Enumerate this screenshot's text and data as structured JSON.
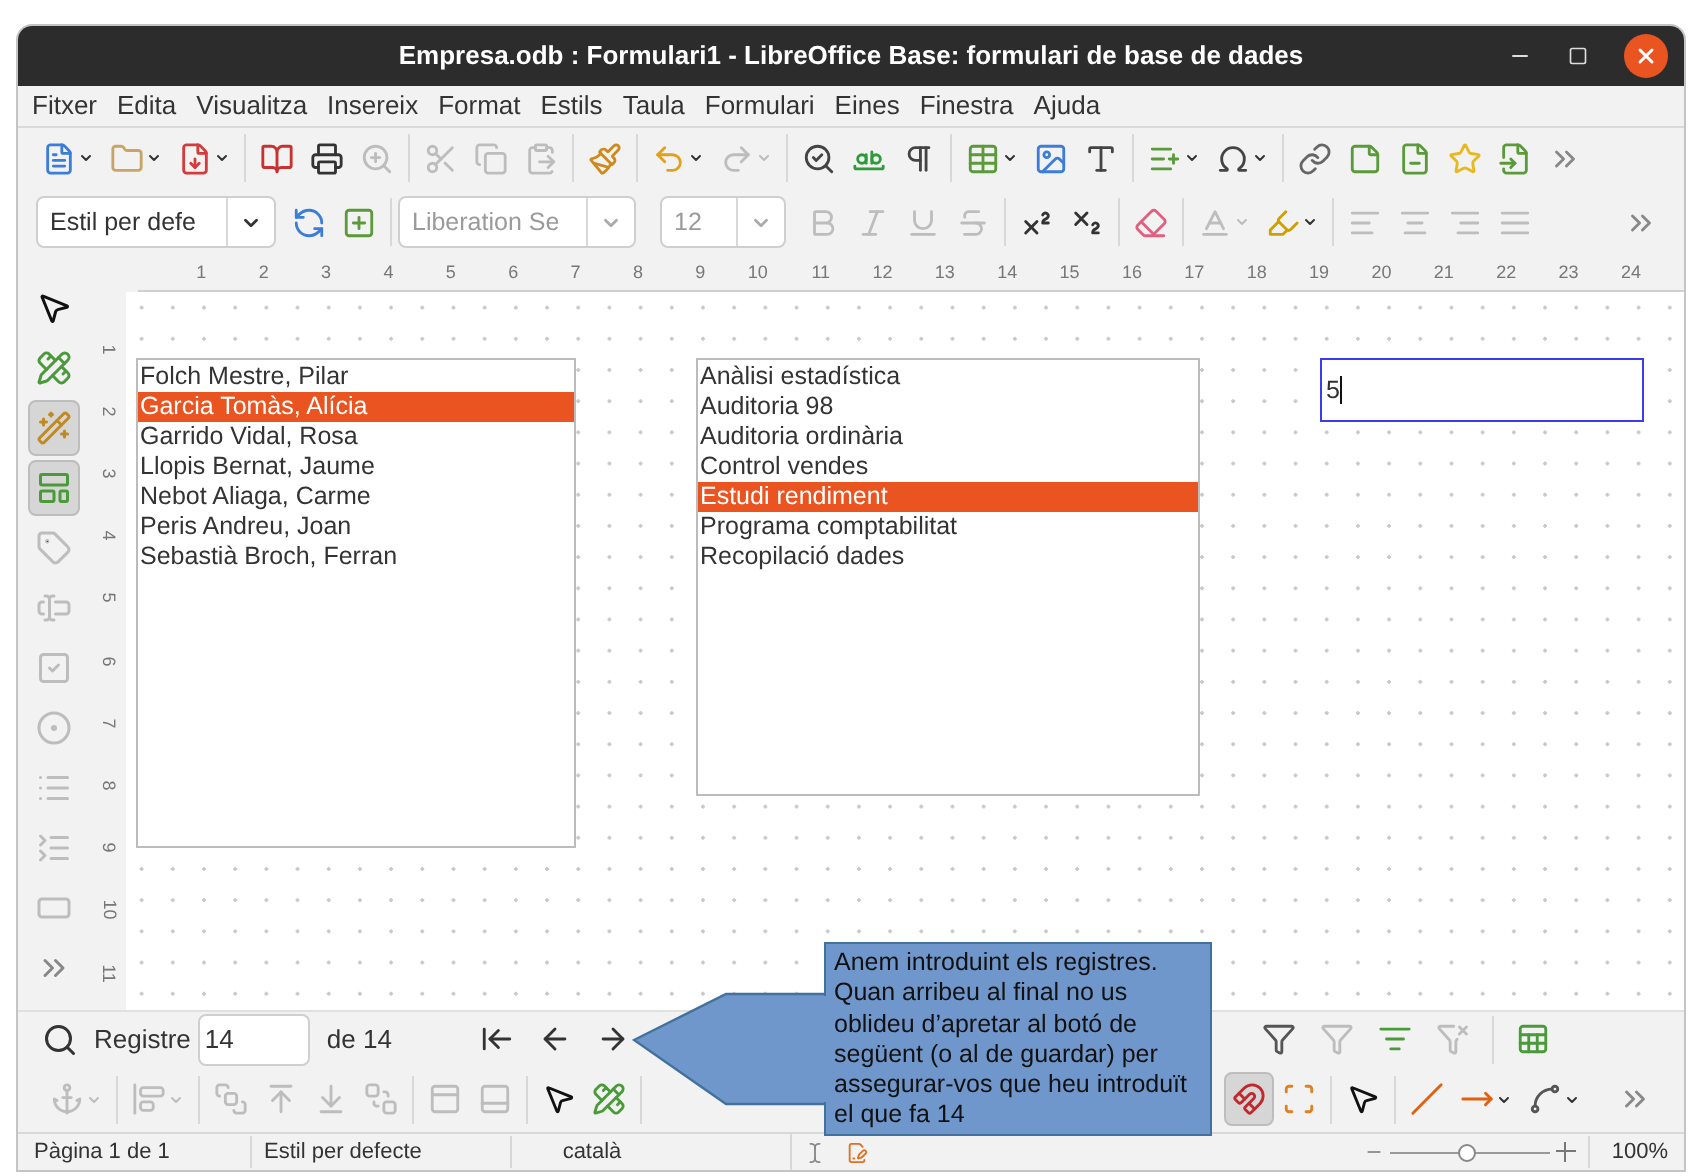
{
  "window": {
    "title": "Empresa.odb : Formulari1 - LibreOffice Base: formulari de base de dades"
  },
  "menu": [
    "Fitxer",
    "Edita",
    "Visualitza",
    "Insereix",
    "Format",
    "Estils",
    "Taula",
    "Formulari",
    "Eines",
    "Finestra",
    "Ajuda"
  ],
  "standard_toolbar": [
    {
      "kind": "new",
      "disabled": false,
      "dropdown": true
    },
    {
      "kind": "open",
      "disabled": false,
      "dropdown": true
    },
    {
      "kind": "save",
      "disabled": false,
      "dropdown": true
    },
    {
      "kind": "sep"
    },
    {
      "kind": "pdf",
      "disabled": false,
      "dropdown": false
    },
    {
      "kind": "print",
      "disabled": false,
      "dropdown": false
    },
    {
      "kind": "preview",
      "disabled": true,
      "dropdown": false
    },
    {
      "kind": "sep"
    },
    {
      "kind": "cut",
      "disabled": true,
      "dropdown": false
    },
    {
      "kind": "copy",
      "disabled": true,
      "dropdown": false
    },
    {
      "kind": "paste",
      "disabled": true,
      "dropdown": false
    },
    {
      "kind": "sep"
    },
    {
      "kind": "clone",
      "disabled": false,
      "dropdown": false
    },
    {
      "kind": "sep"
    },
    {
      "kind": "undo",
      "disabled": false,
      "dropdown": true
    },
    {
      "kind": "redo",
      "disabled": true,
      "dropdown": true
    },
    {
      "kind": "sep"
    },
    {
      "kind": "spelling",
      "disabled": false,
      "dropdown": false
    },
    {
      "kind": "autocorrect",
      "disabled": false,
      "dropdown": false
    },
    {
      "kind": "marks",
      "disabled": false,
      "dropdown": false
    },
    {
      "kind": "sep"
    },
    {
      "kind": "table",
      "disabled": false,
      "dropdown": true
    },
    {
      "kind": "image",
      "disabled": false,
      "dropdown": false
    },
    {
      "kind": "textbox",
      "disabled": false,
      "dropdown": false
    },
    {
      "kind": "sep"
    },
    {
      "kind": "list",
      "disabled": false,
      "dropdown": true
    },
    {
      "kind": "special",
      "disabled": false,
      "dropdown": true
    },
    {
      "kind": "sep"
    },
    {
      "kind": "hyperlink",
      "disabled": false,
      "dropdown": false
    },
    {
      "kind": "footnote",
      "disabled": false,
      "dropdown": false
    },
    {
      "kind": "endnote",
      "disabled": false,
      "dropdown": false
    },
    {
      "kind": "bookmark",
      "disabled": false,
      "dropdown": false
    },
    {
      "kind": "crossref",
      "disabled": false,
      "dropdown": false
    },
    {
      "kind": "more",
      "disabled": false,
      "dropdown": false
    }
  ],
  "formatting_toolbar": {
    "paragraph_style": {
      "value": "Estil per defe",
      "disabled": false
    },
    "font_name": {
      "value": "Liberation Se",
      "disabled": true
    },
    "font_size": {
      "value": "12",
      "disabled": true
    },
    "buttons": [
      {
        "kind": "update_style",
        "disabled": false,
        "dropdown": false
      },
      {
        "kind": "new_style",
        "disabled": false,
        "dropdown": false
      },
      {
        "kind": "sep"
      },
      {
        "kind": "bold",
        "disabled": true,
        "dropdown": false
      },
      {
        "kind": "italic",
        "disabled": true,
        "dropdown": false
      },
      {
        "kind": "underline",
        "disabled": true,
        "dropdown": false
      },
      {
        "kind": "strike",
        "disabled": true,
        "dropdown": false
      },
      {
        "kind": "sep"
      },
      {
        "kind": "superscript",
        "disabled": false,
        "dropdown": false
      },
      {
        "kind": "subscript",
        "disabled": false,
        "dropdown": false
      },
      {
        "kind": "sep"
      },
      {
        "kind": "clear",
        "disabled": false,
        "dropdown": false
      },
      {
        "kind": "sep"
      },
      {
        "kind": "fontcolor",
        "disabled": true,
        "dropdown": true
      },
      {
        "kind": "highlight",
        "disabled": false,
        "dropdown": true
      },
      {
        "kind": "sep"
      },
      {
        "kind": "align_left",
        "disabled": true,
        "dropdown": false
      },
      {
        "kind": "align_center",
        "disabled": true,
        "dropdown": false
      },
      {
        "kind": "align_right",
        "disabled": true,
        "dropdown": false
      },
      {
        "kind": "justify",
        "disabled": true,
        "dropdown": false
      },
      {
        "kind": "gap"
      },
      {
        "kind": "more",
        "disabled": false,
        "dropdown": false
      }
    ]
  },
  "ruler": {
    "horizontal": [
      "1",
      "2",
      "3",
      "4",
      "5",
      "6",
      "7",
      "8",
      "9",
      "10",
      "11",
      "12",
      "13",
      "14",
      "15",
      "16",
      "17",
      "18",
      "19",
      "20",
      "21",
      "22",
      "23",
      "24"
    ],
    "vertical": [
      "1",
      "2",
      "3",
      "4",
      "5",
      "6",
      "7",
      "8",
      "9",
      "10",
      "11"
    ]
  },
  "form_controls_toolbar": [
    {
      "kind": "select",
      "on": false,
      "disabled": false
    },
    {
      "kind": "design",
      "on": false,
      "disabled": false
    },
    {
      "kind": "wizards",
      "on": true,
      "disabled": false
    },
    {
      "kind": "form_design",
      "on": true,
      "disabled": false
    },
    {
      "kind": "label",
      "on": false,
      "disabled": true
    },
    {
      "kind": "text",
      "on": false,
      "disabled": true
    },
    {
      "kind": "checkbox",
      "on": false,
      "disabled": true
    },
    {
      "kind": "radio",
      "on": false,
      "disabled": true
    },
    {
      "kind": "listbox",
      "on": false,
      "disabled": true
    },
    {
      "kind": "combobox",
      "on": false,
      "disabled": true
    },
    {
      "kind": "pushbutton",
      "on": false,
      "disabled": true
    },
    {
      "kind": "more",
      "on": false,
      "disabled": false
    }
  ],
  "form": {
    "employees_list": [
      {
        "label": "Folch Mestre, Pilar",
        "selected": false
      },
      {
        "label": "Garcia Tomàs, Alícia",
        "selected": true
      },
      {
        "label": "Garrido Vidal, Rosa",
        "selected": false
      },
      {
        "label": "Llopis Bernat, Jaume",
        "selected": false
      },
      {
        "label": "Nebot Aliaga, Carme",
        "selected": false
      },
      {
        "label": "Peris Andreu, Joan",
        "selected": false
      },
      {
        "label": "Sebastià Broch, Ferran",
        "selected": false
      }
    ],
    "projects_list": [
      {
        "label": "Anàlisi estadística",
        "selected": false
      },
      {
        "label": "Auditoria 98",
        "selected": false
      },
      {
        "label": "Auditoria ordinària",
        "selected": false
      },
      {
        "label": "Control vendes",
        "selected": false
      },
      {
        "label": "Estudi rendiment",
        "selected": true
      },
      {
        "label": "Programa comptabilitat",
        "selected": false
      },
      {
        "label": "Recopilació dades",
        "selected": false
      }
    ],
    "hours_field": {
      "value": "5",
      "focused": true
    }
  },
  "navigation_toolbar": {
    "record_label": "Registre",
    "record_value": "14",
    "record_total": "de 14",
    "buttons": [
      {
        "kind": "first",
        "disabled": false
      },
      {
        "kind": "prev",
        "disabled": false
      },
      {
        "kind": "next",
        "disabled": false
      }
    ],
    "filter_buttons": [
      {
        "kind": "autofilter",
        "disabled": false
      },
      {
        "kind": "apply_filter",
        "disabled": true
      },
      {
        "kind": "standard_filter",
        "disabled": false
      },
      {
        "kind": "reset_filter",
        "disabled": true
      },
      {
        "kind": "sep"
      },
      {
        "kind": "data_to_text",
        "disabled": false
      }
    ]
  },
  "form_design_toolbar": [
    {
      "kind": "anchor",
      "disabled": true,
      "dropdown": true,
      "on": false
    },
    {
      "kind": "sep"
    },
    {
      "kind": "align",
      "disabled": true,
      "dropdown": true,
      "on": false
    },
    {
      "kind": "sep"
    },
    {
      "kind": "front",
      "disabled": true,
      "dropdown": false,
      "on": false
    },
    {
      "kind": "forward",
      "disabled": true,
      "dropdown": false,
      "on": false
    },
    {
      "kind": "backward",
      "disabled": true,
      "dropdown": false,
      "on": false
    },
    {
      "kind": "back",
      "disabled": true,
      "dropdown": false,
      "on": false
    },
    {
      "kind": "sep"
    },
    {
      "kind": "header",
      "disabled": true,
      "dropdown": false,
      "on": false
    },
    {
      "kind": "footer",
      "disabled": true,
      "dropdown": false,
      "on": false
    },
    {
      "kind": "sep"
    },
    {
      "kind": "select",
      "disabled": false,
      "dropdown": false,
      "on": false
    },
    {
      "kind": "design",
      "disabled": false,
      "dropdown": false,
      "on": false
    },
    {
      "kind": "sep"
    },
    {
      "kind": "hidden"
    },
    {
      "kind": "snap",
      "disabled": false,
      "dropdown": false,
      "on": true
    },
    {
      "kind": "helplines",
      "disabled": false,
      "dropdown": false,
      "on": false
    },
    {
      "kind": "sep"
    },
    {
      "kind": "select",
      "disabled": false,
      "dropdown": false,
      "on": false
    },
    {
      "kind": "sep"
    },
    {
      "kind": "line",
      "disabled": false,
      "dropdown": false,
      "on": false
    },
    {
      "kind": "arrow",
      "disabled": false,
      "dropdown": true,
      "on": false
    },
    {
      "kind": "curve",
      "disabled": false,
      "dropdown": true,
      "on": false
    },
    {
      "kind": "gap"
    },
    {
      "kind": "more",
      "disabled": false,
      "dropdown": false,
      "on": false
    }
  ],
  "status_bar": {
    "page": "Pàgina 1 de 1",
    "style": "Estil per defecte",
    "language": "català",
    "zoom": {
      "level": 0.47
    },
    "zoom_value": "100%"
  },
  "callout": {
    "text": "Anem introduint els registres. Quan arribeu al final no us oblideu d’apretar al botó de següent (o al de guardar) per assegurar-vos que heu introduït el que fa 14"
  }
}
